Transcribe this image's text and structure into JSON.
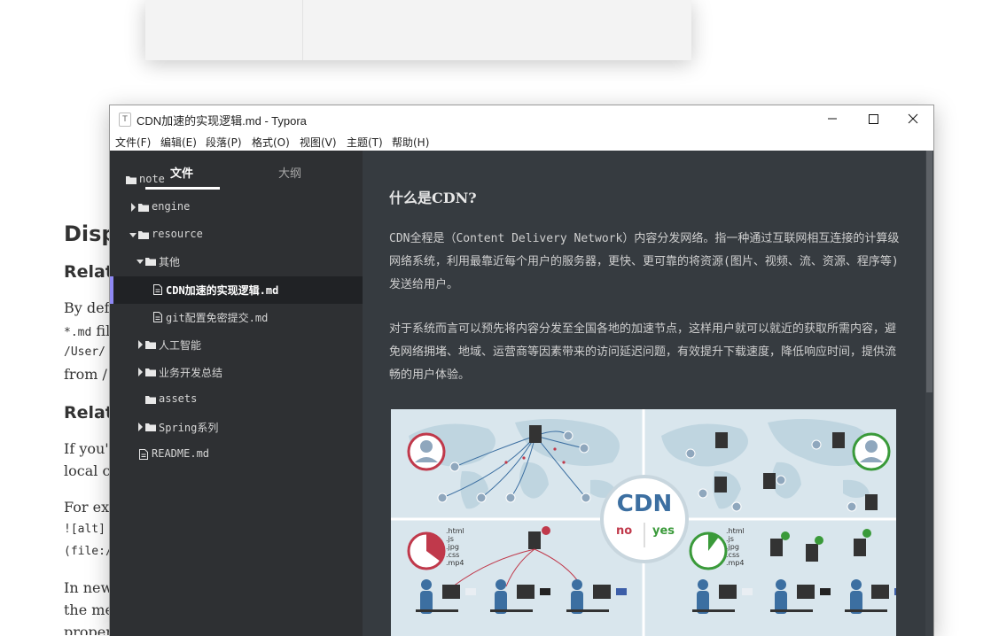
{
  "background_doc": {
    "heading": "Disp",
    "sub1": "Relati",
    "p1": "By defa",
    "p2_code": "*.md",
    "p2_text": " fil",
    "p3": "/User/",
    "p4": "from /",
    "sub2": "Relati",
    "p5": "If you'",
    "p6": "local co",
    "p7": "For exa",
    "p8": "![alt]",
    "p9": "(file:/",
    "p10": "In new",
    "p11": "the me",
    "p12": "proper"
  },
  "window": {
    "title": "CDN加速的实现逻辑.md - Typora",
    "app_icon": "T",
    "controls": {
      "minimize_icon": "minimize-icon",
      "maximize_icon": "maximize-icon",
      "close_icon": "close-icon"
    }
  },
  "menu": [
    "文件(F)",
    "编辑(E)",
    "段落(P)",
    "格式(O)",
    "视图(V)",
    "主题(T)",
    "帮助(H)"
  ],
  "sidebar": {
    "tabs": {
      "files": "文件",
      "outline": "大纲"
    },
    "tree": [
      {
        "label": "note",
        "icon": "folder-icon",
        "toggle": "none"
      },
      {
        "label": "engine",
        "icon": "folder-icon",
        "toggle": "collapsed"
      },
      {
        "label": "resource",
        "icon": "folder-icon",
        "toggle": "expanded"
      },
      {
        "label": "其他",
        "icon": "folder-icon",
        "toggle": "expanded"
      },
      {
        "label": "CDN加速的实现逻辑.md",
        "icon": "file-icon",
        "toggle": "none",
        "active": true
      },
      {
        "label": "git配置免密提交.md",
        "icon": "file-icon",
        "toggle": "none"
      },
      {
        "label": "人工智能",
        "icon": "folder-icon",
        "toggle": "collapsed"
      },
      {
        "label": "业务开发总结",
        "icon": "folder-icon",
        "toggle": "collapsed"
      },
      {
        "label": "assets",
        "icon": "folder-icon",
        "toggle": "none"
      },
      {
        "label": "Spring系列",
        "icon": "folder-icon",
        "toggle": "collapsed"
      },
      {
        "label": "README.md",
        "icon": "file-icon",
        "toggle": "none"
      }
    ]
  },
  "editor": {
    "heading": "什么是CDN?",
    "paragraph1": "CDN全程是（Content Delivery Network）内容分发网络。指一种通过互联网相互连接的计算级网络系统，利用最靠近每个用户的服务器，更快、更可靠的将资源(图片、视频、流、资源、程序等)发送给用户。",
    "paragraph2": "对于系统而言可以预先将内容分发至全国各地的加速节点，这样用户就可以就近的获取所需内容，避免网络拥堵、地域、运营商等因素带来的访问延迟问题，有效提升下载速度，降低响应时间，提供流畅的用户体验。",
    "figure": {
      "center_title": "CDN",
      "no_label": "no",
      "yes_label": "yes",
      "file_types": [
        ".html",
        ".js",
        ".jpg",
        ".css",
        ".mp4"
      ],
      "colors": {
        "no": "#c0394b",
        "yes": "#3a9a3a",
        "accent_blue": "#3c6fa1",
        "map": "#b7cfdc"
      }
    }
  },
  "colors": {
    "sidebar_bg": "#2e3033",
    "editor_bg": "#363b40",
    "active_marker": "#8f89f5"
  }
}
